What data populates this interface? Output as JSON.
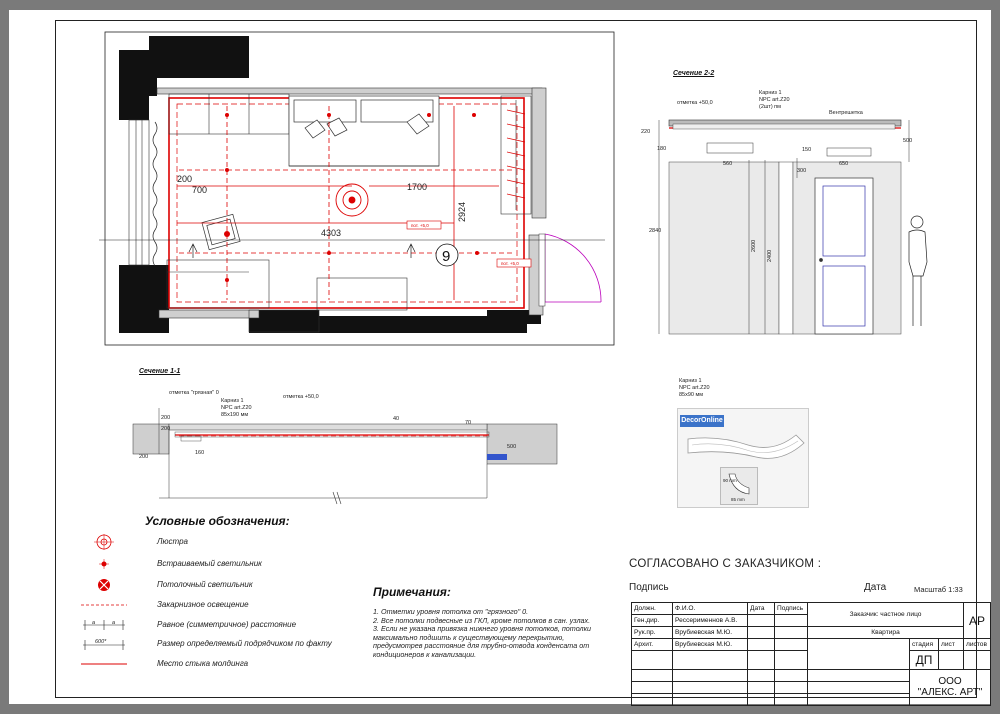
{
  "plan": {
    "room_number": "9",
    "dims": {
      "d200": "200",
      "d700": "700",
      "d1700": "1700",
      "d4303": "4303",
      "d2924": "2924"
    },
    "callouts": {
      "c1": "пот. +5,0",
      "c2": "пот. +5,0"
    }
  },
  "section_22": {
    "title": "Сечение 2-2",
    "labels": {
      "otmetka": "отметка +50,0",
      "karniz": "Карниз 1",
      "karniz2": "NPC art.Z20",
      "karniz3": "(2шт) пм",
      "pot": "Вентрешетка"
    },
    "dims": {
      "d220": "220",
      "d180": "180",
      "d500": "500",
      "d560": "560",
      "d150": "150",
      "d300": "300",
      "d650": "650",
      "d2840": "2840",
      "d2600": "2600",
      "d2400": "2400"
    }
  },
  "section_11": {
    "title": "Сечение 1-1",
    "labels": {
      "otmetka1": "отметка \"грязная\" 0",
      "karniz": "Карниз 1",
      "karniz2": "NPC art.Z20",
      "karniz3": "85х190 мм",
      "otmetka2": "отметка +50,0"
    },
    "dims": {
      "d200a": "200",
      "d200b": "200",
      "d200c": "200",
      "d160": "160",
      "d40": "40",
      "d70": "70",
      "d500": "500"
    }
  },
  "catalog": {
    "line1": "Карниз 1",
    "line2": "NPC art.Z20",
    "line3": "85х90 мм",
    "badge": "DecorOnline",
    "dim_h": "90 mm",
    "dim_w": "85 mm"
  },
  "legend": {
    "title": "Условные обозначения:",
    "items": [
      "Люстра",
      "Встраиваемый светильник",
      "Потолочный светильник",
      "Закарнизное освещение",
      "Равное (симметричное) расстояние",
      "Размер определяемый подрядчиком по факту",
      "Место стыка молдинга"
    ],
    "sym_a": "a",
    "sym_600": "600*"
  },
  "notes": {
    "title": "Примечания:",
    "lines": [
      "1.  Отметки уровня потолка от \"грязного\" 0.",
      "2. Все потолки подвесные из ГКЛ, кроме потолков в сан. узлах.",
      "3. Если не указана привязка нижнего уровня потолков, потолки максимально подшить к существующему перекрытию, предусмотрев расстояние для трубно-отвода конденсата от кондиционеров к канализации."
    ]
  },
  "approval": {
    "title": "СОГЛАСОВАНО С ЗАКАЗЧИКОМ :",
    "sign": "Подпись",
    "date": "Дата",
    "scale": "Масштаб  1:33"
  },
  "stamp": {
    "h_dolzhn": "Должн.",
    "h_fio": "Ф.И.О.",
    "h_data": "Дата",
    "h_podpis": "Подпись",
    "r1_role": "Ген.дир.",
    "r1_name": "Рессерименнов А.В.",
    "r2_role": "Рук.пр.",
    "r2_name": "Врубиевская М.Ю.",
    "r3_role": "Архит.",
    "r3_name": "Врубиевская М.Ю.",
    "customer": "Заказчик:   частное лицо",
    "object": "Квартира",
    "code": "АР",
    "stadia": "стадия",
    "list": "лист",
    "listov": "листов",
    "stage": "ДП",
    "company_line1": "ООО",
    "company_line2": "\"АЛЕКС. АРТ\""
  }
}
